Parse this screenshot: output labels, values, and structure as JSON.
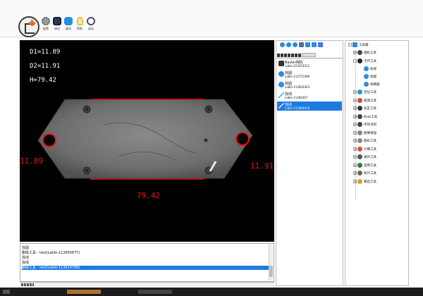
{
  "toolbar": {
    "buttons": [
      {
        "label": "配置",
        "icon": "gear-icon",
        "color": "#9a9a9a"
      },
      {
        "label": "调试",
        "icon": "monitor-icon",
        "color": "#2b3a57"
      },
      {
        "label": "复码",
        "icon": "lock-icon",
        "color": "#2a8de0"
      },
      {
        "label": "帮助",
        "icon": "lightbulb-icon",
        "color": "#f0c040"
      },
      {
        "label": "退出",
        "icon": "power-icon",
        "color": "#4a4a6a"
      }
    ]
  },
  "viewer": {
    "d1": "D1=11.89",
    "d2": "D2=11.91",
    "h": "H=79.42",
    "left_value": "11.89",
    "right_value": "11.91",
    "bottom_value": "79.42",
    "accent": "#e8141c"
  },
  "log": {
    "lines": [
      {
        "text": "找圆",
        "selected": false
      },
      {
        "text": "删除工具 - test(Lable-112856677)",
        "selected": false
      },
      {
        "text": "找线",
        "selected": false
      },
      {
        "text": "找线",
        "selected": false
      },
      {
        "text": "删除工具 - test(Lable-113014768)",
        "selected": true
      }
    ]
  },
  "middle": {
    "items": [
      {
        "title": "Basler相机",
        "sub": "Lable-103254212",
        "icon": "camera-icon",
        "selected": false
      },
      {
        "title": "找圆",
        "sub": "Lable-112715496",
        "icon": "circle-icon",
        "selected": false
      },
      {
        "title": "找圆",
        "sub": "Lable-112826363",
        "icon": "circle-icon",
        "selected": false
      },
      {
        "title": "找线",
        "sub": "Lable-11284467",
        "icon": "line-icon",
        "selected": false
      },
      {
        "title": "找线",
        "sub": "Lable-112904518",
        "icon": "line-icon",
        "selected": true
      }
    ]
  },
  "tree": {
    "root": "工具箱",
    "rows": [
      {
        "label": "相机工具",
        "icon": "camera-icon",
        "color": "#444",
        "level": 1
      },
      {
        "label": "卡尺工具",
        "icon": "caliper-icon",
        "color": "#222",
        "level": 1
      },
      {
        "label": "找线",
        "icon": "line-icon",
        "color": "#2a8de0",
        "level": 2
      },
      {
        "label": "找圆",
        "icon": "circle-icon",
        "color": "#2a8de0",
        "level": 2
      },
      {
        "label": "找椭圆",
        "icon": "ellipse-icon",
        "color": "#2a8de0",
        "level": 2
      },
      {
        "label": "定位工具",
        "icon": "target-icon",
        "color": "#20a0c0",
        "level": 1
      },
      {
        "label": "图测工具",
        "icon": "measure-icon",
        "color": "#e04040",
        "level": 1
      },
      {
        "label": "标定工具",
        "icon": "calibrate-icon",
        "color": "#333",
        "level": 1
      },
      {
        "label": "Blob工具",
        "icon": "blob-icon",
        "color": "#444",
        "level": 1
      },
      {
        "label": "字符识别",
        "icon": "ocr-icon",
        "color": "#444",
        "level": 1
      },
      {
        "label": "图像增强",
        "icon": "enhance-icon",
        "color": "#888",
        "level": 1
      },
      {
        "label": "图形工具",
        "icon": "shape-icon",
        "color": "#888",
        "level": 1
      },
      {
        "label": "计算工具",
        "icon": "calc-icon",
        "color": "#e05030",
        "level": 1
      },
      {
        "label": "通讯工具",
        "icon": "comm-icon",
        "color": "#555",
        "level": 1
      },
      {
        "label": "常用工具",
        "icon": "common-icon",
        "color": "#2a8040",
        "level": 1
      },
      {
        "label": "统计工具",
        "icon": "stats-icon",
        "color": "#666",
        "level": 1
      },
      {
        "label": "输出工具",
        "icon": "output-icon",
        "color": "#e0a020",
        "level": 1
      }
    ]
  }
}
